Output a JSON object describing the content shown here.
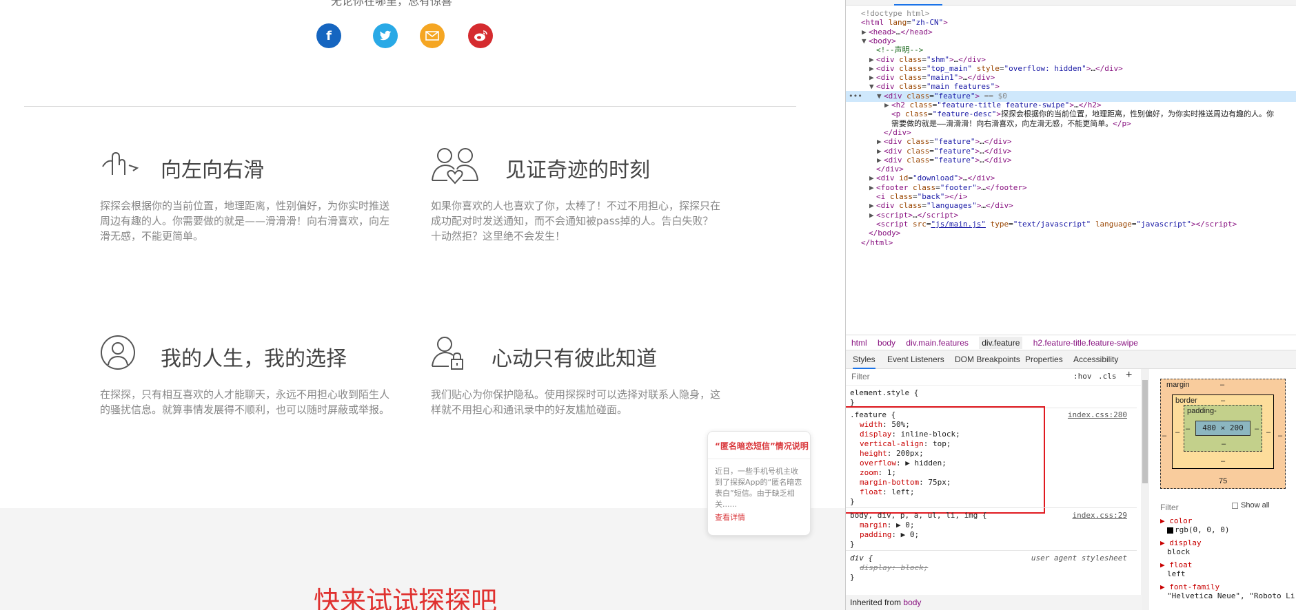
{
  "page": {
    "top_text": "无论你在哪里，总有惊喜",
    "social": [
      {
        "icon": "facebook-icon",
        "glyph": "f",
        "color": "#1565c0"
      },
      {
        "icon": "twitter-icon",
        "glyph": "🐦",
        "color": "#29a9e6"
      },
      {
        "icon": "mail-icon",
        "glyph": "✉",
        "color": "#f5a623"
      },
      {
        "icon": "weibo-icon",
        "glyph": "◎",
        "color": "#d52b2f"
      }
    ],
    "features": [
      {
        "icon": "swipe-hand-icon",
        "title": "向左向右滑",
        "desc": "探探会根据你的当前位置，地理距离，性别偏好，为你实时推送周边有趣的人。你需要做的就是——滑滑滑！向右滑喜欢，向左滑无感，不能更简单。"
      },
      {
        "icon": "couple-heart-icon",
        "title": "见证奇迹的时刻",
        "desc": "如果你喜欢的人也喜欢了你，太棒了！不过不用担心，探探只在成功配对时发送通知，而不会通知被pass掉的人。告白失败？十动然拒？这里绝不会发生！"
      },
      {
        "icon": "person-circle-icon",
        "title": "我的人生，我的选择",
        "desc": "在探探，只有相互喜欢的人才能聊天，永远不用担心收到陌生人的骚扰信息。就算事情发展得不顺利，也可以随时屏蔽或举报。"
      },
      {
        "icon": "person-lock-icon",
        "title": "心动只有彼此知道",
        "desc": "我们贴心为你保护隐私。使用探探时可以选择对联系人隐身，这样就不用担心和通讯录中的好友尴尬碰面。"
      }
    ],
    "notice": {
      "title": "“匿名暗恋短信”情况说明",
      "body": "近日，一些手机号机主收到了探探App的“匿名暗恋表白”短信。由于缺乏相关......",
      "link": "查看详情"
    },
    "cta": "快来试试探探吧"
  },
  "devtools": {
    "dom_lines": [
      {
        "indent": 0,
        "html": "<span class='gry'>&lt;!doctype html&gt;</span>"
      },
      {
        "indent": 0,
        "html": "<span class='tag'>&lt;html</span> <span class='attr'>lang</span>=<span class='val'>\"zh-CN\"</span><span class='tag'>&gt;</span>"
      },
      {
        "indent": 1,
        "tri": "▶",
        "html": "<span class='tag'>&lt;head&gt;</span>…<span class='tag'>&lt;/head&gt;</span>"
      },
      {
        "indent": 1,
        "tri": "▼",
        "html": "<span class='tag'>&lt;body&gt;</span>"
      },
      {
        "indent": 2,
        "html": "<span class='cmt'>&lt;!--声明--&gt;</span>"
      },
      {
        "indent": 2,
        "tri": "▶",
        "html": "<span class='tag'>&lt;div</span> <span class='attr'>class</span>=<span class='val'>\"shm\"</span><span class='tag'>&gt;</span>…<span class='tag'>&lt;/div&gt;</span>"
      },
      {
        "indent": 2,
        "tri": "▶",
        "html": "<span class='tag'>&lt;div</span> <span class='attr'>class</span>=<span class='val'>\"top_main\"</span> <span class='attr'>style</span>=<span class='val'>\"overflow: hidden\"</span><span class='tag'>&gt;</span>…<span class='tag'>&lt;/div&gt;</span>"
      },
      {
        "indent": 2,
        "tri": "▶",
        "html": "<span class='tag'>&lt;div</span> <span class='attr'>class</span>=<span class='val'>\"main1\"</span><span class='tag'>&gt;</span>…<span class='tag'>&lt;/div&gt;</span>"
      },
      {
        "indent": 2,
        "tri": "▼",
        "html": "<span class='tag'>&lt;div</span> <span class='attr'>class</span>=<span class='val'>\"main features\"</span><span class='tag'>&gt;</span>"
      },
      {
        "indent": 3,
        "tri": "▼",
        "sel": true,
        "html": "<span class='tag'>&lt;div</span> <span class='attr'>class</span>=<span class='val'>\"feature\"</span><span class='tag'>&gt;</span> <span class='gry'>== $0</span>"
      },
      {
        "indent": 4,
        "tri": "▶",
        "html": "<span class='tag'>&lt;h2</span> <span class='attr'>class</span>=<span class='val'>\"feature-title feature-swipe\"</span><span class='tag'>&gt;</span>…<span class='tag'>&lt;/h2&gt;</span>"
      },
      {
        "indent": 4,
        "html": "<span class='tag'>&lt;p</span> <span class='attr'>class</span>=<span class='val'>\"feature-desc\"</span><span class='tag'>&gt;</span><span class='txt'>探探会根据你的当前位置，地理距离，性别偏好，为你实时推送周边有趣的人。你</span>"
      },
      {
        "indent": 4,
        "html": "<span class='txt'>需要做的就是——滑滑滑！向右滑喜欢，向左滑无感，不能更简单。</span><span class='tag'>&lt;/p&gt;</span>"
      },
      {
        "indent": 3,
        "html": "<span class='tag'>&lt;/div&gt;</span>"
      },
      {
        "indent": 3,
        "tri": "▶",
        "html": "<span class='tag'>&lt;div</span> <span class='attr'>class</span>=<span class='val'>\"feature\"</span><span class='tag'>&gt;</span>…<span class='tag'>&lt;/div&gt;</span>"
      },
      {
        "indent": 3,
        "tri": "▶",
        "html": "<span class='tag'>&lt;div</span> <span class='attr'>class</span>=<span class='val'>\"feature\"</span><span class='tag'>&gt;</span>…<span class='tag'>&lt;/div&gt;</span>"
      },
      {
        "indent": 3,
        "tri": "▶",
        "html": "<span class='tag'>&lt;div</span> <span class='attr'>class</span>=<span class='val'>\"feature\"</span><span class='tag'>&gt;</span>…<span class='tag'>&lt;/div&gt;</span>"
      },
      {
        "indent": 2,
        "html": "<span class='tag'>&lt;/div&gt;</span>"
      },
      {
        "indent": 2,
        "tri": "▶",
        "html": "<span class='tag'>&lt;div</span> <span class='attr'>id</span>=<span class='val'>\"download\"</span><span class='tag'>&gt;</span>…<span class='tag'>&lt;/div&gt;</span>"
      },
      {
        "indent": 2,
        "tri": "▶",
        "html": "<span class='tag'>&lt;footer</span> <span class='attr'>class</span>=<span class='val'>\"footer\"</span><span class='tag'>&gt;</span>…<span class='tag'>&lt;/footer&gt;</span>"
      },
      {
        "indent": 2,
        "html": "<span class='tag'>&lt;i</span> <span class='attr'>class</span>=<span class='val'>\"back\"</span><span class='tag'>&gt;&lt;/i&gt;</span>"
      },
      {
        "indent": 2,
        "tri": "▶",
        "html": "<span class='tag'>&lt;div</span> <span class='attr'>class</span>=<span class='val'>\"languages\"</span><span class='tag'>&gt;</span>…<span class='tag'>&lt;/div&gt;</span>"
      },
      {
        "indent": 2,
        "tri": "▶",
        "html": "<span class='tag'>&lt;script&gt;</span>…<span class='tag'>&lt;/script&gt;</span>"
      },
      {
        "indent": 2,
        "html": "<span class='tag'>&lt;script</span> <span class='attr'>src</span>=<span class='val' style='text-decoration:underline'>\"js/main.js\"</span> <span class='attr'>type</span>=<span class='val'>\"text/javascript\"</span> <span class='attr'>language</span>=<span class='val'>\"javascript\"</span><span class='tag'>&gt;&lt;/script&gt;</span>"
      },
      {
        "indent": 1,
        "html": "<span class='tag'>&lt;/body&gt;</span>"
      },
      {
        "indent": 0,
        "html": "<span class='tag'>&lt;/html&gt;</span>"
      }
    ],
    "breadcrumbs": [
      "html",
      "body",
      "div.main.features",
      "div.feature",
      "h2.feature-title.feature-swipe"
    ],
    "tabs": [
      "Styles",
      "Event Listeners",
      "DOM Breakpoints",
      "Properties",
      "Accessibility"
    ],
    "styles_filter": "Filter",
    "hov": ":hov",
    "cls": ".cls",
    "plus": "+",
    "element_style": "element.style {",
    "close_brace": "}",
    "feature_rule": {
      "selector": ".feature {",
      "source": "index.css:280",
      "props": [
        {
          "n": "width",
          "v": "50%;"
        },
        {
          "n": "display",
          "v": "inline-block;"
        },
        {
          "n": "vertical-align",
          "v": "top;"
        },
        {
          "n": "height",
          "v": "200px;"
        },
        {
          "n": "overflow",
          "v": "▶ hidden;"
        },
        {
          "n": "zoom",
          "v": "1;"
        },
        {
          "n": "margin-bottom",
          "v": "75px;"
        },
        {
          "n": "float",
          "v": "left;"
        }
      ]
    },
    "reset_rule": {
      "selector": "body, div, p, a, ul, li, img {",
      "source": "index.css:29",
      "props": [
        {
          "n": "margin",
          "v": "▶ 0;"
        },
        {
          "n": "padding",
          "v": "▶ 0;"
        }
      ]
    },
    "div_rule": {
      "selector": "div {",
      "source": "user agent stylesheet",
      "prop": "display: block;"
    },
    "inherited_label": "Inherited from",
    "inherited_from": "body",
    "box_model": {
      "margin_label": "margin",
      "border_label": "border",
      "padding_label": "padding-",
      "content": "480 × 200",
      "dash": "–",
      "margin_bottom": "75"
    },
    "computed": {
      "filter": "Filter",
      "show_all": "Show all",
      "items": [
        {
          "n": "color",
          "v": "rgb(0, 0, 0)",
          "swatch": true
        },
        {
          "n": "display",
          "v": "block"
        },
        {
          "n": "float",
          "v": "left"
        },
        {
          "n": "font-family",
          "v": "\"Helvetica Neue\", \"Roboto Li"
        }
      ]
    }
  }
}
